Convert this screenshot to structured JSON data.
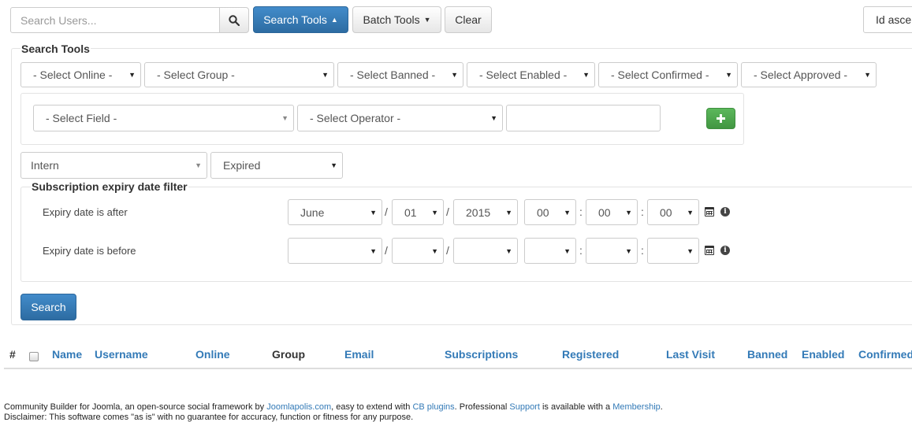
{
  "search": {
    "placeholder": "Search Users...",
    "button_icon": "search-icon"
  },
  "toolbar": {
    "search_tools_label": "Search Tools",
    "batch_tools_label": "Batch Tools",
    "clear_label": "Clear",
    "sort_label": "Id asce"
  },
  "search_tools": {
    "legend": "Search Tools",
    "filters": {
      "online": "- Select Online -",
      "group": "- Select Group -",
      "banned": "- Select Banned -",
      "enabled": "- Select Enabled -",
      "confirmed": "- Select Confirmed -",
      "approved": "- Select Approved -"
    },
    "field_filter": {
      "field": "- Select Field -",
      "operator": "- Select Operator -",
      "value": ""
    },
    "plan_select": "Intern",
    "status_select": "Expired",
    "expiry": {
      "legend": "Subscription expiry date filter",
      "after_label": "Expiry date is after",
      "before_label": "Expiry date is before",
      "date_sep": "/",
      "time_sep": ":",
      "after": {
        "month": "June",
        "day": "01",
        "year": "2015",
        "hour": "00",
        "minute": "00",
        "second": "00"
      },
      "before": {
        "month": "",
        "day": "",
        "year": "",
        "hour": "",
        "minute": "",
        "second": ""
      }
    },
    "search_button": "Search"
  },
  "table": {
    "columns": [
      "#",
      "Name",
      "Username",
      "Online",
      "Group",
      "Email",
      "Subscriptions",
      "Registered",
      "Last Visit",
      "Banned",
      "Enabled",
      "Confirmed"
    ]
  },
  "footer": {
    "line1": {
      "t1": "Community Builder for Joomla, an open-source social framework by ",
      "l1": "Joomlapolis.com",
      "t2": ", easy to extend with ",
      "l2": "CB plugins",
      "t3": ". Professional ",
      "l3": "Support",
      "t4": " is available with a ",
      "l4": "Membership",
      "t5": "."
    },
    "line2": "Disclaimer: This software comes \"as is\" with no guarantee for accuracy, function or fitness for any purpose."
  },
  "colors": {
    "primary": "#428bca",
    "success": "#5cb85c",
    "link": "#337ab7"
  }
}
